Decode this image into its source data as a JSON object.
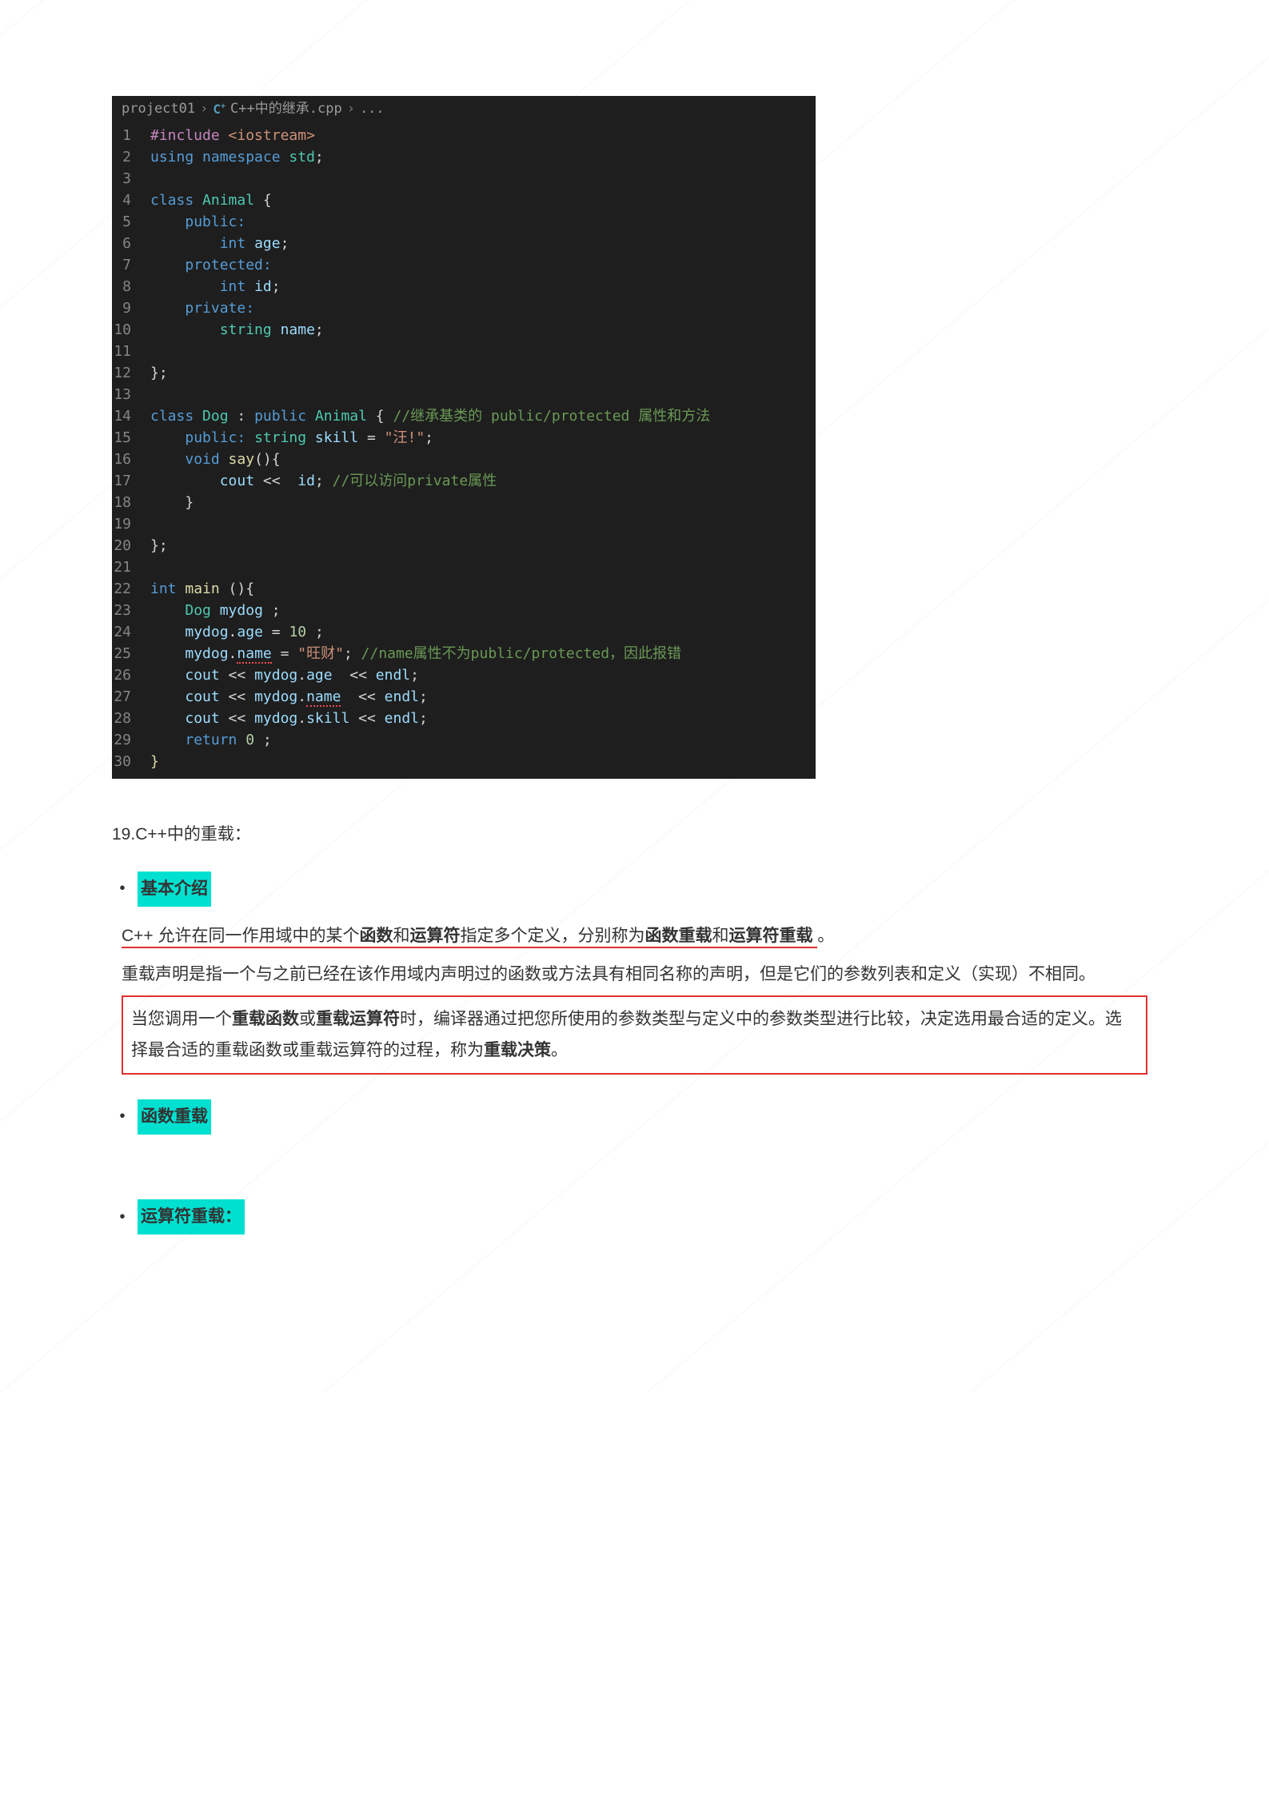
{
  "breadcrumb": {
    "folder": "project01",
    "file": "C++中的继承.cpp",
    "tail": "..."
  },
  "code": [
    {
      "n": 1,
      "tokens": [
        {
          "t": "#include ",
          "c": "t-pre"
        },
        {
          "t": "<iostream>",
          "c": "t-str"
        }
      ]
    },
    {
      "n": 2,
      "tokens": [
        {
          "t": "using ",
          "c": "t-key"
        },
        {
          "t": "namespace ",
          "c": "t-key"
        },
        {
          "t": "std",
          "c": "t-type"
        },
        {
          "t": ";",
          "c": "t-pun"
        }
      ]
    },
    {
      "n": 3,
      "tokens": [
        {
          "t": "",
          "c": ""
        }
      ]
    },
    {
      "n": 4,
      "tokens": [
        {
          "t": "class ",
          "c": "t-key"
        },
        {
          "t": "Animal ",
          "c": "t-type"
        },
        {
          "t": "{",
          "c": "t-pun"
        }
      ]
    },
    {
      "n": 5,
      "g": true,
      "tokens": [
        {
          "t": "    ",
          "c": ""
        },
        {
          "t": "public:",
          "c": "t-key"
        }
      ]
    },
    {
      "n": 6,
      "g": true,
      "tokens": [
        {
          "t": "        ",
          "c": ""
        },
        {
          "t": "int ",
          "c": "t-key"
        },
        {
          "t": "age",
          "c": "t-var"
        },
        {
          "t": ";",
          "c": "t-pun"
        }
      ]
    },
    {
      "n": 7,
      "g": true,
      "tokens": [
        {
          "t": "    ",
          "c": ""
        },
        {
          "t": "protected:",
          "c": "t-key"
        }
      ]
    },
    {
      "n": 8,
      "g": true,
      "tokens": [
        {
          "t": "        ",
          "c": ""
        },
        {
          "t": "int ",
          "c": "t-key"
        },
        {
          "t": "id",
          "c": "t-var"
        },
        {
          "t": ";",
          "c": "t-pun"
        }
      ]
    },
    {
      "n": 9,
      "g": true,
      "tokens": [
        {
          "t": "    ",
          "c": ""
        },
        {
          "t": "private:",
          "c": "t-key"
        }
      ]
    },
    {
      "n": 10,
      "g": true,
      "tokens": [
        {
          "t": "        ",
          "c": ""
        },
        {
          "t": "string ",
          "c": "t-type"
        },
        {
          "t": "name",
          "c": "t-var"
        },
        {
          "t": ";",
          "c": "t-pun"
        }
      ]
    },
    {
      "n": 11,
      "tokens": [
        {
          "t": "",
          "c": ""
        }
      ]
    },
    {
      "n": 12,
      "tokens": [
        {
          "t": "};",
          "c": "t-pun"
        }
      ]
    },
    {
      "n": 13,
      "tokens": [
        {
          "t": "",
          "c": ""
        }
      ]
    },
    {
      "n": 14,
      "tokens": [
        {
          "t": "class ",
          "c": "t-key"
        },
        {
          "t": "Dog ",
          "c": "t-type"
        },
        {
          "t": ": ",
          "c": "t-pun"
        },
        {
          "t": "public ",
          "c": "t-key"
        },
        {
          "t": "Animal ",
          "c": "t-type"
        },
        {
          "t": "{ ",
          "c": "t-pun"
        },
        {
          "t": "//继承基类的 public/protected 属性和方法",
          "c": "t-com"
        }
      ]
    },
    {
      "n": 15,
      "tokens": [
        {
          "t": "    ",
          "c": ""
        },
        {
          "t": "public: ",
          "c": "t-key"
        },
        {
          "t": "string ",
          "c": "t-type"
        },
        {
          "t": "skill ",
          "c": "t-var"
        },
        {
          "t": "= ",
          "c": "t-op"
        },
        {
          "t": "\"汪!\"",
          "c": "t-str"
        },
        {
          "t": ";",
          "c": "t-pun"
        }
      ]
    },
    {
      "n": 16,
      "tokens": [
        {
          "t": "    ",
          "c": ""
        },
        {
          "t": "void ",
          "c": "t-key"
        },
        {
          "t": "say",
          "c": "t-fn"
        },
        {
          "t": "(){",
          "c": "t-pun"
        }
      ]
    },
    {
      "n": 17,
      "tokens": [
        {
          "t": "        ",
          "c": ""
        },
        {
          "t": "cout ",
          "c": "t-var"
        },
        {
          "t": "<<  ",
          "c": "t-op"
        },
        {
          "t": "id",
          "c": "t-var"
        },
        {
          "t": "; ",
          "c": "t-pun"
        },
        {
          "t": "//可以访问private属性",
          "c": "t-com"
        }
      ]
    },
    {
      "n": 18,
      "tokens": [
        {
          "t": "    }",
          "c": "t-pun"
        }
      ]
    },
    {
      "n": 19,
      "tokens": [
        {
          "t": "",
          "c": ""
        }
      ]
    },
    {
      "n": 20,
      "tokens": [
        {
          "t": "};",
          "c": "t-pun"
        }
      ]
    },
    {
      "n": 21,
      "tokens": [
        {
          "t": "",
          "c": ""
        }
      ]
    },
    {
      "n": 22,
      "tokens": [
        {
          "t": "int ",
          "c": "t-key"
        },
        {
          "t": "main ",
          "c": "t-fn"
        },
        {
          "t": "(){",
          "c": "t-pun"
        }
      ]
    },
    {
      "n": 23,
      "tokens": [
        {
          "t": "    ",
          "c": ""
        },
        {
          "t": "Dog ",
          "c": "t-type"
        },
        {
          "t": "mydog ",
          "c": "t-var"
        },
        {
          "t": ";",
          "c": "t-pun"
        }
      ]
    },
    {
      "n": 24,
      "tokens": [
        {
          "t": "    ",
          "c": ""
        },
        {
          "t": "mydog",
          "c": "t-var"
        },
        {
          "t": ".",
          "c": "t-pun"
        },
        {
          "t": "age ",
          "c": "t-var"
        },
        {
          "t": "= ",
          "c": "t-op"
        },
        {
          "t": "10 ",
          "c": "t-num"
        },
        {
          "t": ";",
          "c": "t-pun"
        }
      ]
    },
    {
      "n": 25,
      "tokens": [
        {
          "t": "    ",
          "c": ""
        },
        {
          "t": "mydog",
          "c": "t-var"
        },
        {
          "t": ".",
          "c": "t-pun"
        },
        {
          "t": "name",
          "c": "t-var",
          "e": true
        },
        {
          "t": " = ",
          "c": "t-op"
        },
        {
          "t": "\"旺财\"",
          "c": "t-str"
        },
        {
          "t": "; ",
          "c": "t-pun"
        },
        {
          "t": "//name属性不为public/protected，因此报错",
          "c": "t-com"
        }
      ]
    },
    {
      "n": 26,
      "tokens": [
        {
          "t": "    ",
          "c": ""
        },
        {
          "t": "cout ",
          "c": "t-var"
        },
        {
          "t": "<< ",
          "c": "t-op"
        },
        {
          "t": "mydog",
          "c": "t-var"
        },
        {
          "t": ".",
          "c": "t-pun"
        },
        {
          "t": "age",
          "c": "t-var"
        },
        {
          "t": "  << ",
          "c": "t-op"
        },
        {
          "t": "endl",
          "c": "t-var"
        },
        {
          "t": ";",
          "c": "t-pun"
        }
      ]
    },
    {
      "n": 27,
      "tokens": [
        {
          "t": "    ",
          "c": ""
        },
        {
          "t": "cout ",
          "c": "t-var"
        },
        {
          "t": "<< ",
          "c": "t-op"
        },
        {
          "t": "mydog",
          "c": "t-var"
        },
        {
          "t": ".",
          "c": "t-pun"
        },
        {
          "t": "name",
          "c": "t-var",
          "e": true
        },
        {
          "t": "  << ",
          "c": "t-op"
        },
        {
          "t": "endl",
          "c": "t-var"
        },
        {
          "t": ";",
          "c": "t-pun"
        }
      ]
    },
    {
      "n": 28,
      "tokens": [
        {
          "t": "    ",
          "c": ""
        },
        {
          "t": "cout ",
          "c": "t-var"
        },
        {
          "t": "<< ",
          "c": "t-op"
        },
        {
          "t": "mydog",
          "c": "t-var"
        },
        {
          "t": ".",
          "c": "t-pun"
        },
        {
          "t": "skill",
          "c": "t-var"
        },
        {
          "t": " << ",
          "c": "t-op"
        },
        {
          "t": "endl",
          "c": "t-var"
        },
        {
          "t": ";",
          "c": "t-pun"
        }
      ]
    },
    {
      "n": 29,
      "tokens": [
        {
          "t": "    ",
          "c": ""
        },
        {
          "t": "return ",
          "c": "t-key"
        },
        {
          "t": "0 ",
          "c": "t-num"
        },
        {
          "t": ";",
          "c": "t-pun"
        }
      ]
    },
    {
      "n": 30,
      "tokens": [
        {
          "t": "}",
          "c": "t-fn"
        }
      ]
    }
  ],
  "section_title": "19.C++中的重载：",
  "intro_label": "基本介绍",
  "p1_a": "C++ 允许在同一作用域中的某个",
  "p1_b": "函数",
  "p1_c": "和",
  "p1_d": "运算符",
  "p1_e": "指定多个定义，分别称为",
  "p1_f": "函数重载",
  "p1_g": "和",
  "p1_h": "运算符重载",
  "p1_i": "。",
  "p2": "重载声明是指一个与之前已经在该作用域内声明过的函数或方法具有相同名称的声明，但是它们的参数列表和定义（实现）不相同。",
  "box_a": "当您调用一个",
  "box_b": "重载函数",
  "box_c": "或",
  "box_d": "重载运算符",
  "box_e": "时，编译器通过把您所使用的参数类型与定义中的参数类型进行比较，决定选用最合适的定义。选择最合适的重载函数或重载运算符的过程，称为",
  "box_f": "重载决策",
  "box_g": "。",
  "sub1": "函数重载",
  "sub2": "运算符重载："
}
